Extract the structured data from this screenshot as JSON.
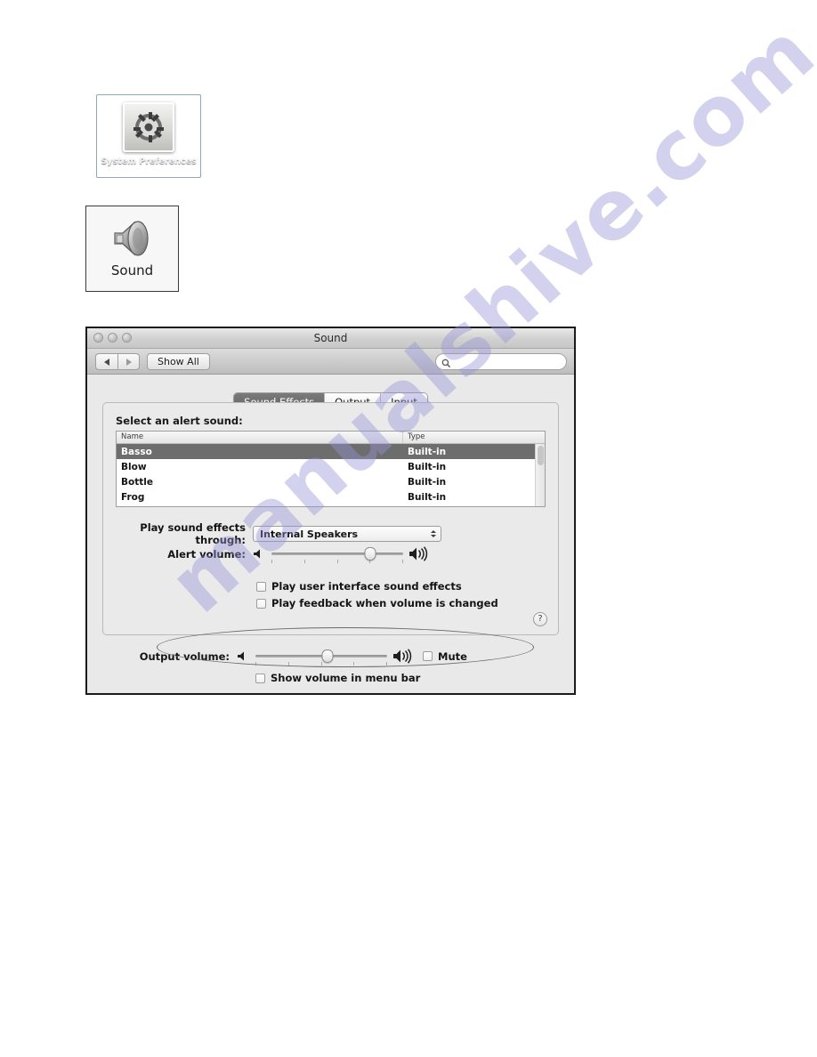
{
  "desktop": {
    "sysprefs_icon": {
      "label": "System Preferences",
      "icon_name": "gear-switch-icon",
      "selection_color": "#4f6d8a"
    },
    "sound_icon": {
      "label": "Sound",
      "icon_name": "speaker-icon"
    }
  },
  "watermark": {
    "text": "manualshive.com",
    "color": "#9694d7"
  },
  "window": {
    "title": "Sound",
    "traffic_lights": [
      "close",
      "minimize",
      "zoom"
    ],
    "toolbar": {
      "back_label": "◀",
      "forward_label": "▶",
      "show_all_label": "Show All",
      "search_placeholder": "",
      "search_value": "",
      "search_icon": "magnifier-icon"
    },
    "tabs": [
      {
        "label": "Sound Effects",
        "active": true
      },
      {
        "label": "Output",
        "active": false
      },
      {
        "label": "Input",
        "active": false
      }
    ],
    "panel": {
      "heading": "Select an alert sound:",
      "table": {
        "columns": [
          "Name",
          "Type"
        ],
        "rows": [
          {
            "name": "Basso",
            "type": "Built-in",
            "selected": true
          },
          {
            "name": "Blow",
            "type": "Built-in",
            "selected": false
          },
          {
            "name": "Bottle",
            "type": "Built-in",
            "selected": false
          },
          {
            "name": "Frog",
            "type": "Built-in",
            "selected": false
          }
        ]
      },
      "play_through": {
        "label": "Play sound effects through:",
        "value": "Internal Speakers"
      },
      "alert_volume": {
        "label": "Alert volume:",
        "value_percent": 75,
        "left_icon": "speaker-low-icon",
        "right_icon": "speaker-high-icon"
      },
      "checkboxes": [
        {
          "label": "Play user interface sound effects",
          "checked": false
        },
        {
          "label": "Play feedback when volume is changed",
          "checked": false
        }
      ],
      "help_label": "?"
    },
    "bottom": {
      "output_volume": {
        "label": "Output volume:",
        "value_percent": 55,
        "left_icon": "speaker-low-icon",
        "right_icon": "speaker-high-icon"
      },
      "mute": {
        "label": "Mute",
        "checked": false
      },
      "show_in_menubar": {
        "label": "Show volume in menu bar",
        "checked": false
      }
    }
  }
}
